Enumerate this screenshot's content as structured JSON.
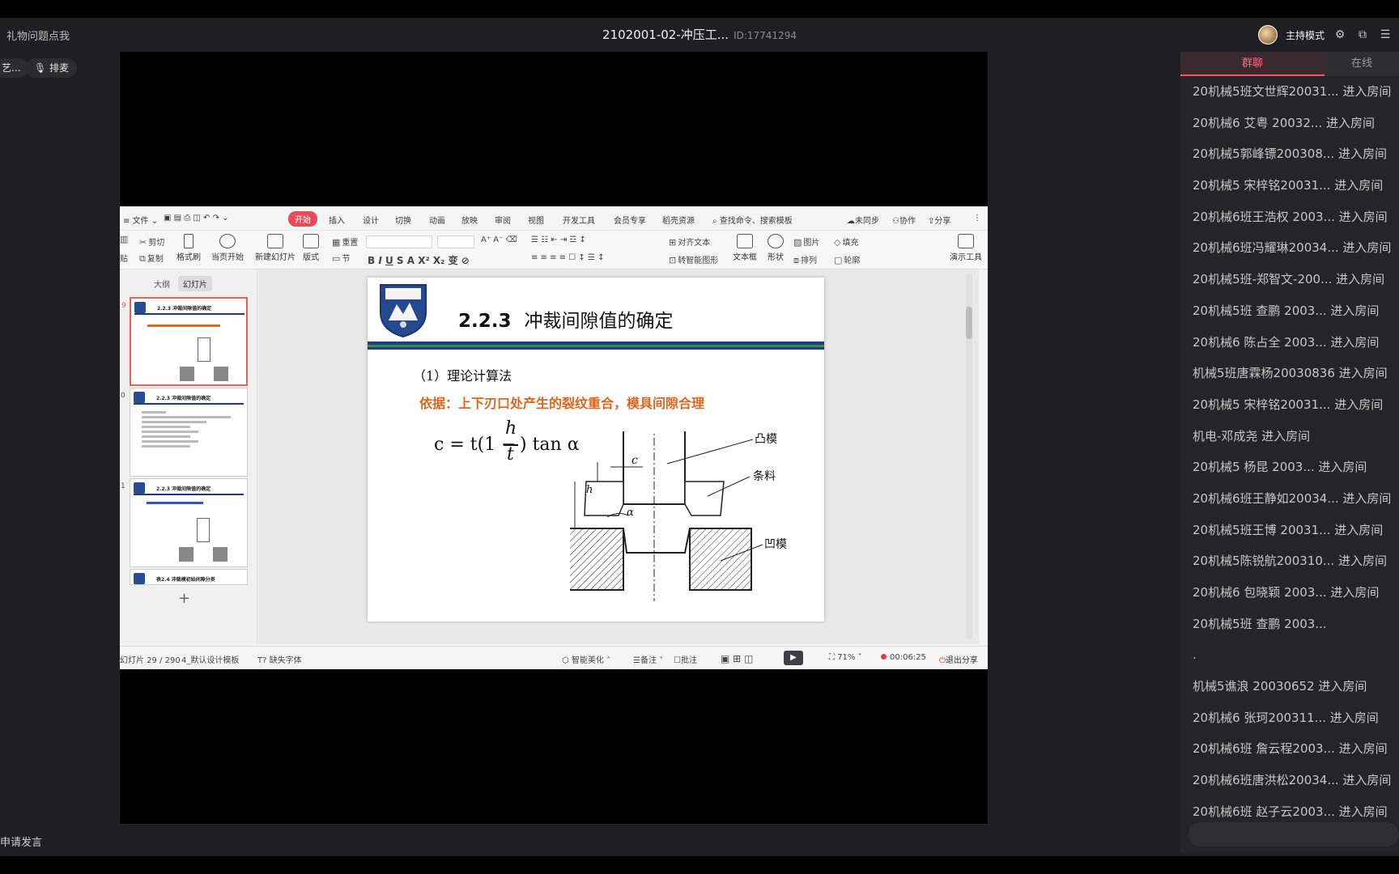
{
  "header": {
    "gift_link": "礼物问题点我",
    "title": "2102001-02-冲压工...",
    "meeting_id": "ID:17741294",
    "host_label": "主持模式"
  },
  "left_chips": {
    "chip1": "艺...",
    "chip2": "排麦"
  },
  "apply_speak": "申请发言",
  "wps": {
    "menu": {
      "file": "文件",
      "tabs": [
        "开始",
        "插入",
        "设计",
        "切换",
        "动画",
        "放映",
        "审阅",
        "视图",
        "开发工具",
        "会员专享",
        "稻壳资源"
      ],
      "search": "查找命令、搜索模板",
      "sync": "未同步",
      "collab": "协作",
      "share": "分享"
    },
    "ribbon": {
      "cut": "剪切",
      "copy": "复制",
      "paste": "贴",
      "format_painter": "格式刷",
      "play_from_current": "当页开始",
      "new_slide": "新建幻灯片",
      "layout": "版式",
      "section": "节",
      "reset": "重置",
      "align_text": "对齐文本",
      "smart_shape": "转智能图形",
      "textbox": "文本框",
      "shape": "形状",
      "arrange": "排列",
      "picture": "图片",
      "fill": "填充",
      "outline": "轮廓",
      "presentation_tools": "演示工具"
    },
    "panes": {
      "outline_tab": "大纲",
      "slides_tab": "幻灯片"
    },
    "thumbnails": [
      {
        "num": "9",
        "title": "2.2.3 冲裁间隙值的确定"
      },
      {
        "num": "0",
        "title": "2.2.3 冲裁间隙值的确定"
      },
      {
        "num": "1",
        "title": "2.2.3 冲裁间隙值的确定"
      },
      {
        "num": "2",
        "title": "表2.4 冲裁模初始间隙分类"
      }
    ],
    "slide": {
      "title_num": "2.2.3",
      "title_text": "冲裁间隙值的确定",
      "method": "（1）理论计算法",
      "basis": "依据：上下刃口处产生的裂纹重合，模具间隙合理",
      "formula": {
        "lhs": "c = t(1 −",
        "num": "h",
        "den": "t",
        "rhs": ") tan α"
      },
      "labels": {
        "punch": "凸模",
        "strip": "条料",
        "die": "凹模",
        "c": "c",
        "h": "h",
        "t": "t",
        "alpha": "α"
      }
    },
    "status": {
      "slide_count": "幻灯片 29 / 290",
      "template": "4_默认设计模板",
      "missing_font": "缺失字体",
      "beautify": "智能美化",
      "notes": "备注",
      "comment": "批注",
      "zoom": "71%",
      "timer": "00:06:25",
      "exit_share": "退出分享"
    }
  },
  "chat": {
    "tab_group": "群聊",
    "tab_online": "在线",
    "messages": [
      "20机械5班文世辉20031... 进入房间",
      "20机械6 艾粤 20032... 进入房间",
      "20机械5郭峰镖200308... 进入房间",
      "20机械5 宋梓铭20031... 进入房间",
      "20机械6班王浩权 2003... 进入房间",
      "20机械6班冯耀琳20034... 进入房间",
      "20机械5班-郑智文-200... 进入房间",
      "20机械5班 查鹏 2003... 进入房间",
      "20机械6 陈占全 2003... 进入房间",
      "机械5班唐霖杨20030836 进入房间",
      "20机械5 宋梓铭20031... 进入房间",
      "机电-邓成尧 进入房间",
      "20机械5  杨昆 2003... 进入房间",
      "20机械6班王静如20034... 进入房间",
      "20机械5班王博 20031... 进入房间",
      "20机械5陈锐航200310... 进入房间",
      "20机械6 包晓颖 2003... 进入房间",
      "20机械5班 查鹏 2003...",
      ".",
      "机械5谯浪 20030652 进入房间",
      "20机械6 张珂200311... 进入房间",
      "20机械6班 詹云程2003... 进入房间",
      "20机械6班唐洪松20034... 进入房间",
      "20机械6班 赵子云2003... 进入房间"
    ]
  }
}
